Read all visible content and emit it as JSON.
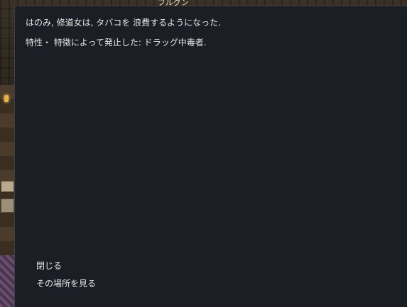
{
  "background": {
    "top_label": "ブルグン"
  },
  "dialog": {
    "messages": [
      "はのみ, 修道女は, タバコを 浪費するようになった.",
      "特性・ 特徴によって発止した: ドラッグ中毒者."
    ],
    "options": [
      "閉じる",
      "その場所を見る"
    ]
  }
}
